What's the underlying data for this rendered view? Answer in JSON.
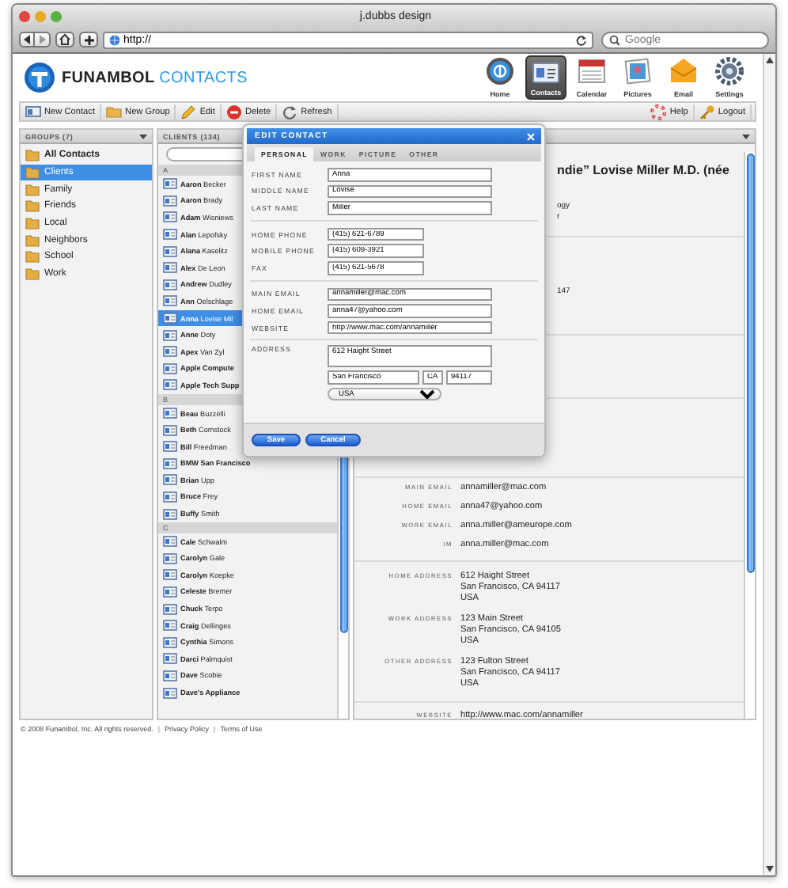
{
  "window": {
    "title": "j.dubbs design"
  },
  "browser": {
    "address": "http://",
    "search_placeholder": "Google"
  },
  "app": {
    "logo_text": "FUNAMBOL",
    "logo_accent": "CONTACTS",
    "nav": [
      {
        "label": "Home",
        "selected": false
      },
      {
        "label": "Contacts",
        "selected": true
      },
      {
        "label": "Calendar",
        "selected": false
      },
      {
        "label": "Pictures",
        "selected": false
      },
      {
        "label": "Email",
        "selected": false
      },
      {
        "label": "Settings",
        "selected": false
      }
    ]
  },
  "toolbar": {
    "left": [
      "New Contact",
      "New Group",
      "Edit",
      "Delete",
      "Refresh"
    ],
    "right": [
      "Help",
      "Logout"
    ]
  },
  "groups": {
    "header": "GROUPS (7)",
    "items": [
      {
        "label": "All Contacts",
        "kind": "all",
        "selected": false
      },
      {
        "label": "Clients",
        "kind": "group",
        "selected": true
      },
      {
        "label": "Family",
        "kind": "group",
        "selected": false
      },
      {
        "label": "Friends",
        "kind": "group",
        "selected": false
      },
      {
        "label": "Local",
        "kind": "group",
        "selected": false
      },
      {
        "label": "Neighbors",
        "kind": "group",
        "selected": false
      },
      {
        "label": "School",
        "kind": "group",
        "selected": false
      },
      {
        "label": "Work",
        "kind": "group",
        "selected": false
      }
    ]
  },
  "contacts": {
    "header": "CLIENTS (134)",
    "sections": [
      {
        "letter": "A",
        "items": [
          {
            "kind": "person",
            "first": "Aaron",
            "last": "Becker",
            "selected": false
          },
          {
            "kind": "person",
            "first": "Aaron",
            "last": "Brady",
            "selected": false
          },
          {
            "kind": "person",
            "first": "Adam",
            "last": "Wisniews",
            "selected": false
          },
          {
            "kind": "person",
            "first": "Alan",
            "last": "Lepofsky",
            "selected": false
          },
          {
            "kind": "person",
            "first": "Alana",
            "last": "Kaselitz",
            "selected": false
          },
          {
            "kind": "person",
            "first": "Alex",
            "last": "De Leon",
            "selected": false
          },
          {
            "kind": "person",
            "first": "Andrew",
            "last": "Dudley",
            "selected": false
          },
          {
            "kind": "person",
            "first": "Ann",
            "last": "Oelschlage",
            "selected": false
          },
          {
            "kind": "person",
            "first": "Anna",
            "last": "Lovise Mil",
            "selected": true
          },
          {
            "kind": "person",
            "first": "Anne",
            "last": "Doty",
            "selected": false
          },
          {
            "kind": "person",
            "first": "Apex",
            "last": "Van Zyl",
            "selected": false
          },
          {
            "kind": "company",
            "name": "Apple Compute",
            "selected": false
          },
          {
            "kind": "company",
            "name": "Apple Tech Supp",
            "selected": false
          }
        ]
      },
      {
        "letter": "B",
        "items": [
          {
            "kind": "person",
            "first": "Beau",
            "last": "Buzzelli",
            "selected": false
          },
          {
            "kind": "person",
            "first": "Beth",
            "last": "Comstock",
            "selected": false
          },
          {
            "kind": "person",
            "first": "Bill",
            "last": "Freedman",
            "selected": false
          },
          {
            "kind": "company",
            "name": "BMW San Francisco",
            "selected": false
          },
          {
            "kind": "person",
            "first": "Brian",
            "last": "Upp",
            "selected": false
          },
          {
            "kind": "person",
            "first": "Bruce",
            "last": "Frey",
            "selected": false
          },
          {
            "kind": "person",
            "first": "Buffy",
            "last": "Smith",
            "selected": false
          }
        ]
      },
      {
        "letter": "C",
        "items": [
          {
            "kind": "person",
            "first": "Cale",
            "last": "Schwalm",
            "selected": false
          },
          {
            "kind": "person",
            "first": "Carolyn",
            "last": "Gale",
            "selected": false
          },
          {
            "kind": "person",
            "first": "Carolyn",
            "last": "Koepke",
            "selected": false
          },
          {
            "kind": "person",
            "first": "Celeste",
            "last": "Bremer",
            "selected": false
          },
          {
            "kind": "person",
            "first": "Chuck",
            "last": "Terpo",
            "selected": false
          },
          {
            "kind": "person",
            "first": "Craig",
            "last": "Dellinges",
            "selected": false
          },
          {
            "kind": "person",
            "first": "Cynthia",
            "last": "Simons",
            "selected": false
          },
          {
            "kind": "person",
            "first": "Darci",
            "last": "Palmquist",
            "selected": false
          },
          {
            "kind": "person",
            "first": "Dave",
            "last": "Scobie",
            "selected": false
          },
          {
            "kind": "company",
            "name": "Dave's Appliance",
            "selected": false
          }
        ]
      }
    ]
  },
  "detail": {
    "name_fragment": "ndie” Lovise Miller M.D. (née",
    "fragments": [
      "ogy",
      "r"
    ],
    "phone_fragment": "147",
    "emails": [
      {
        "label": "MAIN EMAIL",
        "value": "annamiller@mac.com"
      },
      {
        "label": "HOME EMAIL",
        "value": "anna47@yahoo.com"
      },
      {
        "label": "WORK EMAIL",
        "value": "anna.miller@ameurope.com"
      },
      {
        "label": "IM",
        "value": "anna.miller@mac.com"
      }
    ],
    "addresses": [
      {
        "label": "HOME ADDRESS",
        "lines": [
          "612 Haight Street",
          "San Francisco, CA 94117",
          "USA"
        ]
      },
      {
        "label": "WORK ADDRESS",
        "lines": [
          "123 Main Street",
          "San Francisco, CA 94105",
          "USA"
        ]
      },
      {
        "label": "OTHER ADDRESS",
        "lines": [
          "123 Fulton Street",
          "San Francisco, CA 94117",
          "USA"
        ]
      }
    ],
    "website": {
      "label": "WEBSITE",
      "value": "http://www.mac.com/annamiller"
    }
  },
  "edit_dialog": {
    "title": "EDIT CONTACT",
    "tabs": [
      {
        "label": "PERSONAL",
        "selected": true
      },
      {
        "label": "WORK",
        "selected": false
      },
      {
        "label": "PICTURE",
        "selected": false
      },
      {
        "label": "OTHER",
        "selected": false
      }
    ],
    "sections": [
      [
        {
          "label": "FIRST NAME",
          "value": "Anna",
          "kind": "long"
        },
        {
          "label": "MIDDLE NAME",
          "value": "Lovise",
          "kind": "long"
        },
        {
          "label": "LAST NAME",
          "value": "Miller",
          "kind": "long"
        }
      ],
      [
        {
          "label": "HOME PHONE",
          "value": "(415) 621-6789",
          "kind": "short"
        },
        {
          "label": "MOBILE PHONE",
          "value": "(415) 609-3921",
          "kind": "short"
        },
        {
          "label": "FAX",
          "value": "(415) 621-5678",
          "kind": "short"
        }
      ],
      [
        {
          "label": "MAIN EMAIL",
          "value": "annamiller@mac.com",
          "kind": "long"
        },
        {
          "label": "HOME EMAIL",
          "value": "anna47@yahoo.com",
          "kind": "long"
        },
        {
          "label": "WEBSITE",
          "value": "http://www.mac.com/annamiller",
          "kind": "long"
        }
      ]
    ],
    "address": {
      "label": "ADDRESS",
      "street": "612 Haight Street",
      "city": "San Francisco",
      "state": "CA",
      "zip": "94117",
      "country": "USA"
    },
    "buttons": [
      "Save",
      "Cancel"
    ]
  },
  "footer": {
    "copyright": "© 2008 Funambol, Inc. All rights reserved.",
    "links": [
      {
        "separator": "|",
        "label": "Privacy Policy"
      },
      {
        "separator": "|",
        "label": "Terms of Use"
      }
    ]
  }
}
